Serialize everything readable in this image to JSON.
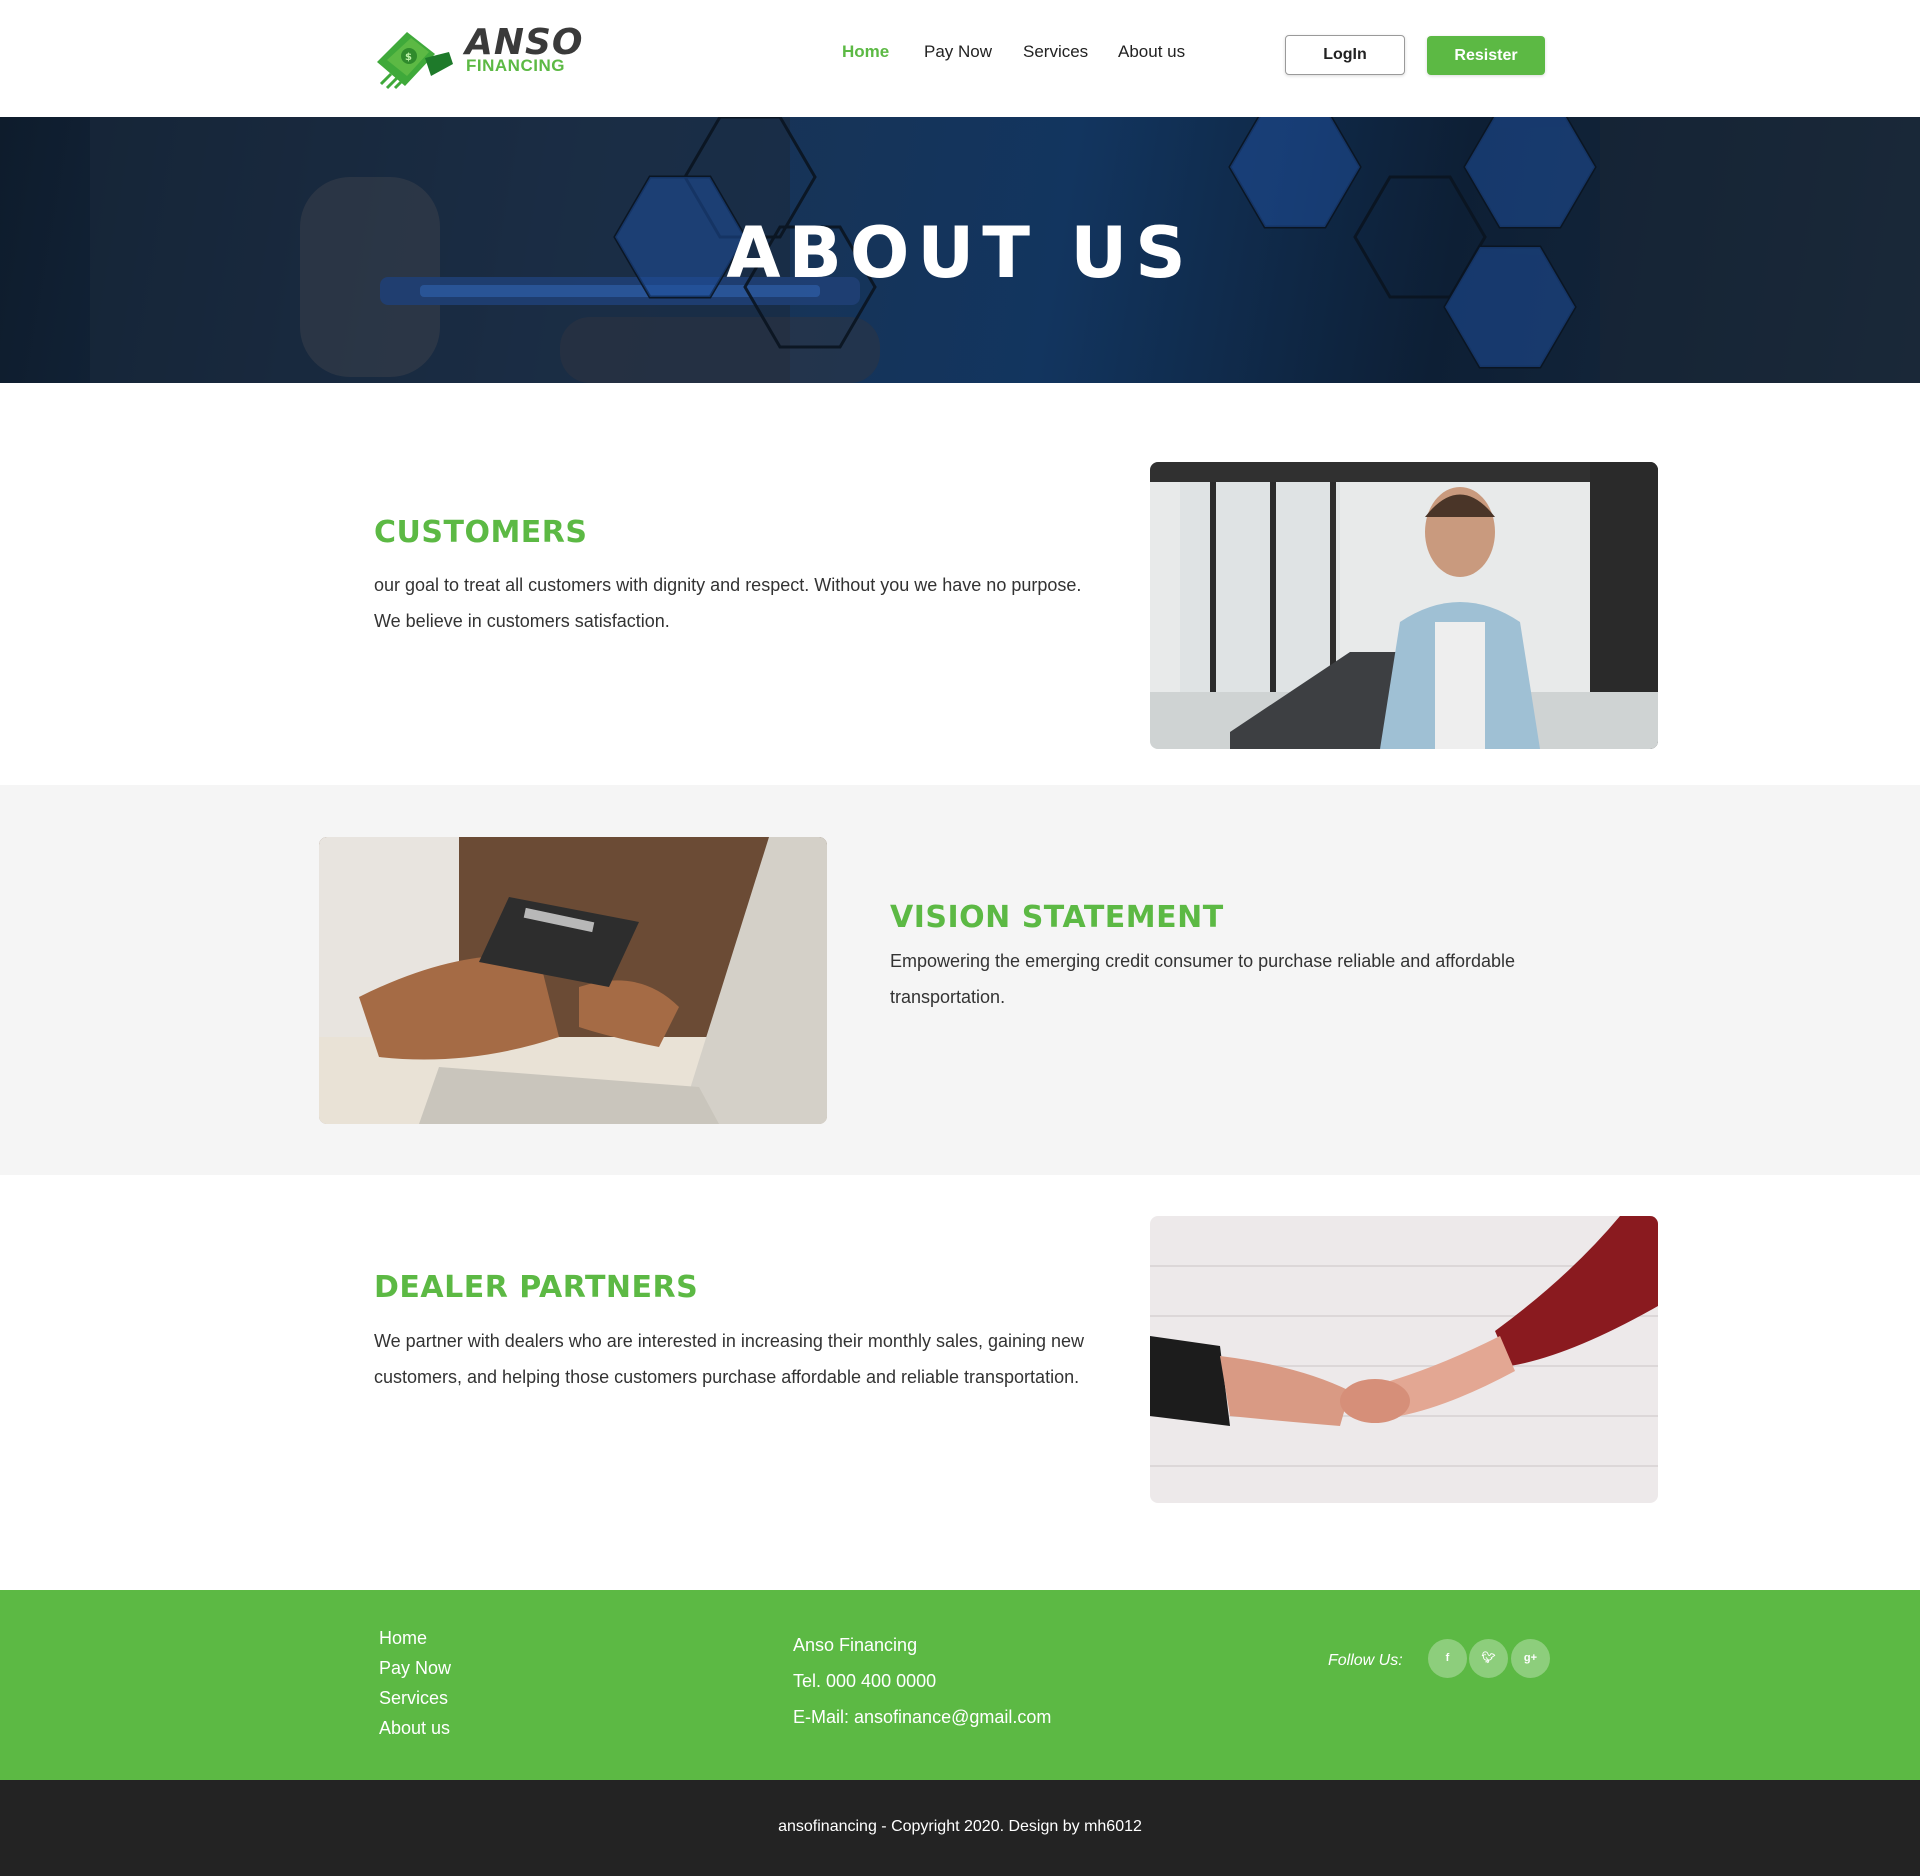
{
  "brand": {
    "name": "ANSO",
    "sub": "FINANCING"
  },
  "nav": {
    "items": [
      "Home",
      "Pay Now",
      "Services",
      "About us"
    ],
    "active": "Home"
  },
  "auth": {
    "login_label": "LogIn",
    "register_label": "Resister"
  },
  "hero": {
    "title": "ABOUT US"
  },
  "sections": [
    {
      "title": "CUSTOMERS",
      "text": "our goal to treat all customers with dignity and respect. Without you we have no purpose. We believe in customers satisfaction."
    },
    {
      "title": "VISION STATEMENT",
      "text": "Empowering the emerging credit consumer to purchase reliable and affordable transportation."
    },
    {
      "title": "DEALER PARTNERS",
      "text": "We partner with dealers who are interested in increasing their monthly sales, gaining new customers, and helping those customers purchase affordable and reliable transportation."
    }
  ],
  "footer": {
    "links": [
      "Home",
      "Pay Now",
      "Services",
      "About us"
    ],
    "company": "Anso Financing",
    "tel": "Tel. 000 400 0000",
    "email": "E-Mail: ansofinance@gmail.com",
    "follow_label": "Follow Us:",
    "social_icons": [
      "facebook-icon",
      "twitter-icon",
      "google-plus-icon"
    ]
  },
  "copyright": "ansofinancing - Copyright 2020. Design by mh6012",
  "colors": {
    "accent": "#5cb944",
    "dark": "#232323",
    "section_alt_bg": "#f5f5f5"
  }
}
